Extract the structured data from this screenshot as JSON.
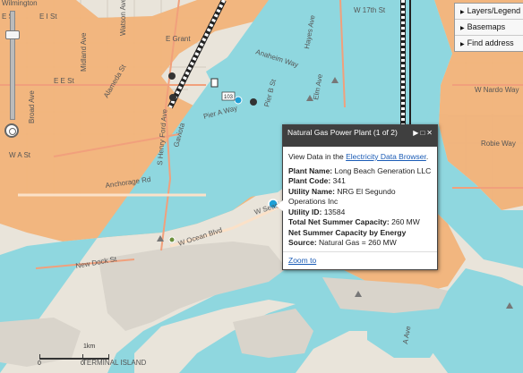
{
  "map_labels": {
    "wilmington": "Wilmington",
    "e_st_top": "E St",
    "e_i_st": "E I St",
    "e_grant": "E Grant",
    "watson_ave": "Watson Ave",
    "midland_ave": "Midland Ave",
    "broad_ave": "Broad Ave",
    "alameda_st": "Alameda St",
    "e_e_st": "E E St",
    "w_a_st": "W A St",
    "pier_a_way": "Pier A Way",
    "gaviota": "Gaviota",
    "s_henry_ford_ave": "S Henry Ford Ave",
    "anchorage_rd": "Anchorage Rd",
    "new_dock_st": "New Dock St",
    "w_ocean_blvd": "W Ocean Blvd",
    "seaside_fwy": "W Seaside Fwy",
    "w_17th_st": "W 17th St",
    "w_nardo_way": "W Nardo Way",
    "robie_way": "Robie Way",
    "pier_b_st": "Pier B St",
    "hayes_ave": "Hayes Ave",
    "elm_ave": "Elm Ave",
    "anaheim_way": "Anaheim Way",
    "a_ave": "A Ave",
    "terminal_island": "TERMINAL ISLAND",
    "route_103": "103"
  },
  "panel": {
    "items": [
      {
        "label": "Layers/Legend"
      },
      {
        "label": "Basemaps"
      },
      {
        "label": "Find address"
      }
    ]
  },
  "popup": {
    "title": "Natural Gas Power Plant (1 of 2)",
    "view_prefix": "View Data in the ",
    "view_link": "Electricity Data Browser",
    "view_suffix": ".",
    "fields": [
      {
        "label": "Plant Name:",
        "value": "Long Beach Generation LLC"
      },
      {
        "label": "Plant Code:",
        "value": "341"
      },
      {
        "label": "Utility Name:",
        "value": "NRG El Segundo Operations Inc"
      },
      {
        "label": "Utility ID:",
        "value": "13584"
      },
      {
        "label": "Total Net Summer Capacity:",
        "value": "260 MW"
      },
      {
        "label": "Net Summer Capacity by Energy Source:",
        "value": "Natural Gas = 260 MW"
      }
    ],
    "zoom_to": "Zoom to"
  },
  "scale": {
    "label_km": "1km",
    "label_zero": "0",
    "label_left": "0"
  },
  "colors": {
    "water": "#8fd7df",
    "zone": "#f2b37a",
    "land": "#e9e4da",
    "popup_header": "#3f3f3f",
    "link": "#1a5bb5"
  }
}
